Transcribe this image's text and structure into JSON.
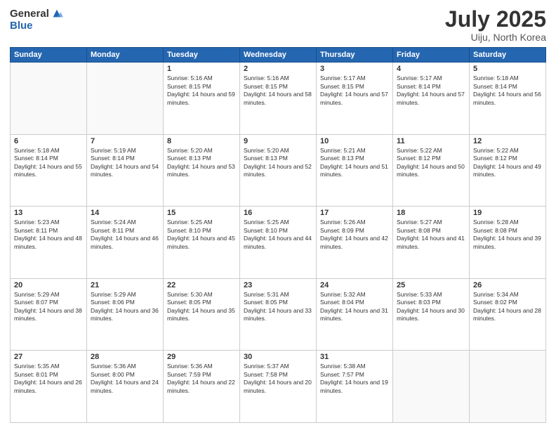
{
  "logo": {
    "general": "General",
    "blue": "Blue"
  },
  "title": "July 2025",
  "location": "Uiju, North Korea",
  "days_of_week": [
    "Sunday",
    "Monday",
    "Tuesday",
    "Wednesday",
    "Thursday",
    "Friday",
    "Saturday"
  ],
  "weeks": [
    [
      {
        "day": "",
        "info": ""
      },
      {
        "day": "",
        "info": ""
      },
      {
        "day": "1",
        "info": "Sunrise: 5:16 AM\nSunset: 8:15 PM\nDaylight: 14 hours and 59 minutes."
      },
      {
        "day": "2",
        "info": "Sunrise: 5:16 AM\nSunset: 8:15 PM\nDaylight: 14 hours and 58 minutes."
      },
      {
        "day": "3",
        "info": "Sunrise: 5:17 AM\nSunset: 8:15 PM\nDaylight: 14 hours and 57 minutes."
      },
      {
        "day": "4",
        "info": "Sunrise: 5:17 AM\nSunset: 8:14 PM\nDaylight: 14 hours and 57 minutes."
      },
      {
        "day": "5",
        "info": "Sunrise: 5:18 AM\nSunset: 8:14 PM\nDaylight: 14 hours and 56 minutes."
      }
    ],
    [
      {
        "day": "6",
        "info": "Sunrise: 5:18 AM\nSunset: 8:14 PM\nDaylight: 14 hours and 55 minutes."
      },
      {
        "day": "7",
        "info": "Sunrise: 5:19 AM\nSunset: 8:14 PM\nDaylight: 14 hours and 54 minutes."
      },
      {
        "day": "8",
        "info": "Sunrise: 5:20 AM\nSunset: 8:13 PM\nDaylight: 14 hours and 53 minutes."
      },
      {
        "day": "9",
        "info": "Sunrise: 5:20 AM\nSunset: 8:13 PM\nDaylight: 14 hours and 52 minutes."
      },
      {
        "day": "10",
        "info": "Sunrise: 5:21 AM\nSunset: 8:13 PM\nDaylight: 14 hours and 51 minutes."
      },
      {
        "day": "11",
        "info": "Sunrise: 5:22 AM\nSunset: 8:12 PM\nDaylight: 14 hours and 50 minutes."
      },
      {
        "day": "12",
        "info": "Sunrise: 5:22 AM\nSunset: 8:12 PM\nDaylight: 14 hours and 49 minutes."
      }
    ],
    [
      {
        "day": "13",
        "info": "Sunrise: 5:23 AM\nSunset: 8:11 PM\nDaylight: 14 hours and 48 minutes."
      },
      {
        "day": "14",
        "info": "Sunrise: 5:24 AM\nSunset: 8:11 PM\nDaylight: 14 hours and 46 minutes."
      },
      {
        "day": "15",
        "info": "Sunrise: 5:25 AM\nSunset: 8:10 PM\nDaylight: 14 hours and 45 minutes."
      },
      {
        "day": "16",
        "info": "Sunrise: 5:25 AM\nSunset: 8:10 PM\nDaylight: 14 hours and 44 minutes."
      },
      {
        "day": "17",
        "info": "Sunrise: 5:26 AM\nSunset: 8:09 PM\nDaylight: 14 hours and 42 minutes."
      },
      {
        "day": "18",
        "info": "Sunrise: 5:27 AM\nSunset: 8:08 PM\nDaylight: 14 hours and 41 minutes."
      },
      {
        "day": "19",
        "info": "Sunrise: 5:28 AM\nSunset: 8:08 PM\nDaylight: 14 hours and 39 minutes."
      }
    ],
    [
      {
        "day": "20",
        "info": "Sunrise: 5:29 AM\nSunset: 8:07 PM\nDaylight: 14 hours and 38 minutes."
      },
      {
        "day": "21",
        "info": "Sunrise: 5:29 AM\nSunset: 8:06 PM\nDaylight: 14 hours and 36 minutes."
      },
      {
        "day": "22",
        "info": "Sunrise: 5:30 AM\nSunset: 8:05 PM\nDaylight: 14 hours and 35 minutes."
      },
      {
        "day": "23",
        "info": "Sunrise: 5:31 AM\nSunset: 8:05 PM\nDaylight: 14 hours and 33 minutes."
      },
      {
        "day": "24",
        "info": "Sunrise: 5:32 AM\nSunset: 8:04 PM\nDaylight: 14 hours and 31 minutes."
      },
      {
        "day": "25",
        "info": "Sunrise: 5:33 AM\nSunset: 8:03 PM\nDaylight: 14 hours and 30 minutes."
      },
      {
        "day": "26",
        "info": "Sunrise: 5:34 AM\nSunset: 8:02 PM\nDaylight: 14 hours and 28 minutes."
      }
    ],
    [
      {
        "day": "27",
        "info": "Sunrise: 5:35 AM\nSunset: 8:01 PM\nDaylight: 14 hours and 26 minutes."
      },
      {
        "day": "28",
        "info": "Sunrise: 5:36 AM\nSunset: 8:00 PM\nDaylight: 14 hours and 24 minutes."
      },
      {
        "day": "29",
        "info": "Sunrise: 5:36 AM\nSunset: 7:59 PM\nDaylight: 14 hours and 22 minutes."
      },
      {
        "day": "30",
        "info": "Sunrise: 5:37 AM\nSunset: 7:58 PM\nDaylight: 14 hours and 20 minutes."
      },
      {
        "day": "31",
        "info": "Sunrise: 5:38 AM\nSunset: 7:57 PM\nDaylight: 14 hours and 19 minutes."
      },
      {
        "day": "",
        "info": ""
      },
      {
        "day": "",
        "info": ""
      }
    ]
  ]
}
